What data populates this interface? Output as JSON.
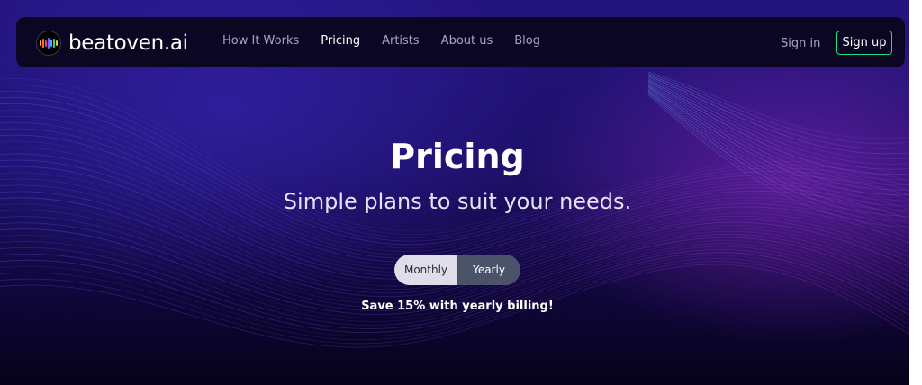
{
  "colors": {
    "background_top": "#241480",
    "background_bottom": "#06031a",
    "navbar": "#0b0722",
    "accent_signup_border": "#19e08a",
    "toggle_inactive": "#dfdde7",
    "toggle_active": "#4b5369"
  },
  "navbar": {
    "logo_icon": "equalizer-bars-icon",
    "brand": "beatoven.ai",
    "links": [
      {
        "label": "How It Works",
        "active": false
      },
      {
        "label": "Pricing",
        "active": true
      },
      {
        "label": "Artists",
        "active": false
      },
      {
        "label": "About us",
        "active": false
      },
      {
        "label": "Blog",
        "active": false
      }
    ],
    "signin_label": "Sign in",
    "signup_label": "Sign up"
  },
  "hero": {
    "title": "Pricing",
    "subtitle": "Simple plans to suit your needs.",
    "billing_toggle": {
      "options": [
        "Monthly",
        "Yearly"
      ],
      "selected": "Yearly"
    },
    "save_note": "Save 15% with yearly billing!"
  }
}
